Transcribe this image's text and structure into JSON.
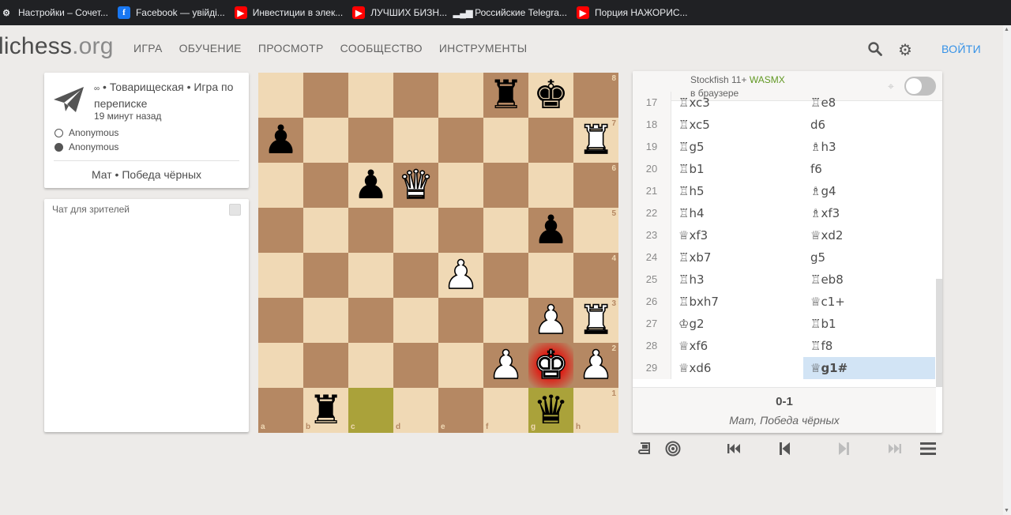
{
  "bookmarks": [
    {
      "label": "Настройки – Сочет...",
      "icon": "gear-icon"
    },
    {
      "label": "Facebook — увійді...",
      "icon": "facebook-icon"
    },
    {
      "label": "Инвестиции в элек...",
      "icon": "youtube-icon"
    },
    {
      "label": "ЛУЧШИХ БИЗН...",
      "icon": "youtube-icon"
    },
    {
      "label": "Российские Telegra...",
      "icon": "bars-icon"
    },
    {
      "label": "Порция НАЖОРИС...",
      "icon": "youtube-icon"
    }
  ],
  "header": {
    "logo_main": "lichess",
    "logo_tld": ".org",
    "nav": [
      "ИГРА",
      "ОБУЧЕНИЕ",
      "ПРОСМОТР",
      "СООБЩЕСТВО",
      "ИНСТРУМЕНТЫ"
    ],
    "login": "ВОЙТИ"
  },
  "game_info": {
    "infinity": "∞",
    "mode": " • Товарищеская • Игра по переписке",
    "time_ago": "19 минут назад",
    "player_white": "Anonymous",
    "player_black": "Anonymous",
    "result": "Мат • Победа чёрных"
  },
  "chat": {
    "title": "Чат для зрителей"
  },
  "engine": {
    "name": "Stockfish 11+",
    "variant": "WASMX",
    "subtitle": "в браузере"
  },
  "board": {
    "pieces": [
      {
        "sq": "f8",
        "p": "♜",
        "c": "b"
      },
      {
        "sq": "g8",
        "p": "♚",
        "c": "b"
      },
      {
        "sq": "a7",
        "p": "♟",
        "c": "b"
      },
      {
        "sq": "h7",
        "p": "♜",
        "c": "w"
      },
      {
        "sq": "c6",
        "p": "♟",
        "c": "b"
      },
      {
        "sq": "d6",
        "p": "♛",
        "c": "w"
      },
      {
        "sq": "g5",
        "p": "♟",
        "c": "b"
      },
      {
        "sq": "e4",
        "p": "♟",
        "c": "w"
      },
      {
        "sq": "g3",
        "p": "♟",
        "c": "w"
      },
      {
        "sq": "h3",
        "p": "♜",
        "c": "w"
      },
      {
        "sq": "f2",
        "p": "♟",
        "c": "w"
      },
      {
        "sq": "g2",
        "p": "♚",
        "c": "w"
      },
      {
        "sq": "h2",
        "p": "♟",
        "c": "w"
      },
      {
        "sq": "b1",
        "p": "♜",
        "c": "b"
      },
      {
        "sq": "g1",
        "p": "♛",
        "c": "b"
      }
    ],
    "last_move": [
      "c1",
      "g1"
    ],
    "check": "g2",
    "ranks": [
      "8",
      "7",
      "6",
      "5",
      "4",
      "3",
      "2",
      "1"
    ],
    "files": [
      "a",
      "b",
      "c",
      "d",
      "e",
      "f",
      "g",
      "h"
    ]
  },
  "moves": [
    {
      "n": "17",
      "w": "♖xc3",
      "b": "♖e8"
    },
    {
      "n": "18",
      "w": "♖xc5",
      "b": "d6"
    },
    {
      "n": "19",
      "w": "♖g5",
      "b": "♗h3"
    },
    {
      "n": "20",
      "w": "♖b1",
      "b": "f6"
    },
    {
      "n": "21",
      "w": "♖h5",
      "b": "♗g4"
    },
    {
      "n": "22",
      "w": "♖h4",
      "b": "♗xf3"
    },
    {
      "n": "23",
      "w": "♕xf3",
      "b": "♕xd2"
    },
    {
      "n": "24",
      "w": "♖xb7",
      "b": "g5"
    },
    {
      "n": "25",
      "w": "♖h3",
      "b": "♖eb8"
    },
    {
      "n": "26",
      "w": "♖bxh7",
      "b": "♕c1+"
    },
    {
      "n": "27",
      "w": "♔g2",
      "b": "♖b1"
    },
    {
      "n": "28",
      "w": "♕xf6",
      "b": "♖f8"
    },
    {
      "n": "29",
      "w": "♕xd6",
      "b": "♕g1#"
    }
  ],
  "active_move": "♕g1#",
  "result": {
    "score": "0-1",
    "status": "Мат, Победа чёрных"
  }
}
